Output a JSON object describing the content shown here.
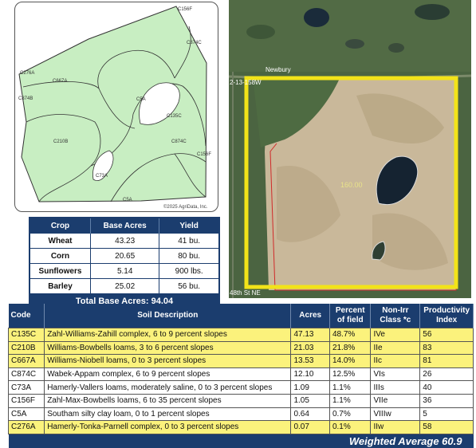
{
  "soil_map": {
    "copyright": "©2025 AgriData, Inc.",
    "labels": [
      "C156F",
      "C874C",
      "C276A",
      "C667A",
      "C874B",
      "C5A",
      "C135C",
      "C210B",
      "C874C",
      "C156F",
      "C73A",
      "C5A"
    ]
  },
  "aerial": {
    "road_name": "Newbury",
    "top_coord": "2-13-158W",
    "bottom_coord": "48th St NE",
    "acres_label": "160.00"
  },
  "crop_table": {
    "headers": [
      "Crop",
      "Base Acres",
      "Yield"
    ],
    "rows": [
      {
        "crop": "Wheat",
        "base_acres": "43.23",
        "yield": "41 bu."
      },
      {
        "crop": "Corn",
        "base_acres": "20.65",
        "yield": "80 bu."
      },
      {
        "crop": "Sunflowers",
        "base_acres": "5.14",
        "yield": "900 lbs."
      },
      {
        "crop": "Barley",
        "base_acres": "25.02",
        "yield": "56 bu."
      }
    ],
    "total": "Total Base Acres: 94.04"
  },
  "soil_table": {
    "headers": {
      "code": "Code",
      "description": "Soil Description",
      "acres": "Acres",
      "percent": "Percent of field",
      "class": "Non-Irr Class *c",
      "index": "Productivity Index"
    },
    "rows": [
      {
        "code": "C135C",
        "description": "Zahl-Williams-Zahill complex, 6 to 9 percent slopes",
        "acres": "47.13",
        "percent": "48.7%",
        "class": "IVe",
        "index": "56",
        "highlight": true
      },
      {
        "code": "C210B",
        "description": "Williams-Bowbells loams, 3 to 6 percent slopes",
        "acres": "21.03",
        "percent": "21.8%",
        "class": "IIe",
        "index": "83",
        "highlight": true
      },
      {
        "code": "C667A",
        "description": "Williams-Niobell loams, 0 to 3 percent slopes",
        "acres": "13.53",
        "percent": "14.0%",
        "class": "IIc",
        "index": "81",
        "highlight": true
      },
      {
        "code": "C874C",
        "description": "Wabek-Appam complex, 6 to 9 percent slopes",
        "acres": "12.10",
        "percent": "12.5%",
        "class": "VIs",
        "index": "26",
        "highlight": false
      },
      {
        "code": "C73A",
        "description": "Hamerly-Vallers loams, moderately saline, 0 to 3 percent slopes",
        "acres": "1.09",
        "percent": "1.1%",
        "class": "IIIs",
        "index": "40",
        "highlight": false
      },
      {
        "code": "C156F",
        "description": "Zahl-Max-Bowbells loams, 6 to 35 percent slopes",
        "acres": "1.05",
        "percent": "1.1%",
        "class": "VIIe",
        "index": "36",
        "highlight": false
      },
      {
        "code": "C5A",
        "description": "Southam silty clay loam, 0 to 1 percent slopes",
        "acres": "0.64",
        "percent": "0.7%",
        "class": "VIIIw",
        "index": "5",
        "highlight": false
      },
      {
        "code": "C276A",
        "description": "Hamerly-Tonka-Parnell complex, 0 to 3 percent slopes",
        "acres": "0.07",
        "percent": "0.1%",
        "class": "IIw",
        "index": "58",
        "highlight": true
      }
    ],
    "weighted_average": "Weighted Average  60.9"
  },
  "colors": {
    "header_navy": "#1b3d6e",
    "highlight_yellow": "#fbf27c",
    "map_green": "#c8eec2",
    "boundary_yellow": "#f2e319"
  }
}
